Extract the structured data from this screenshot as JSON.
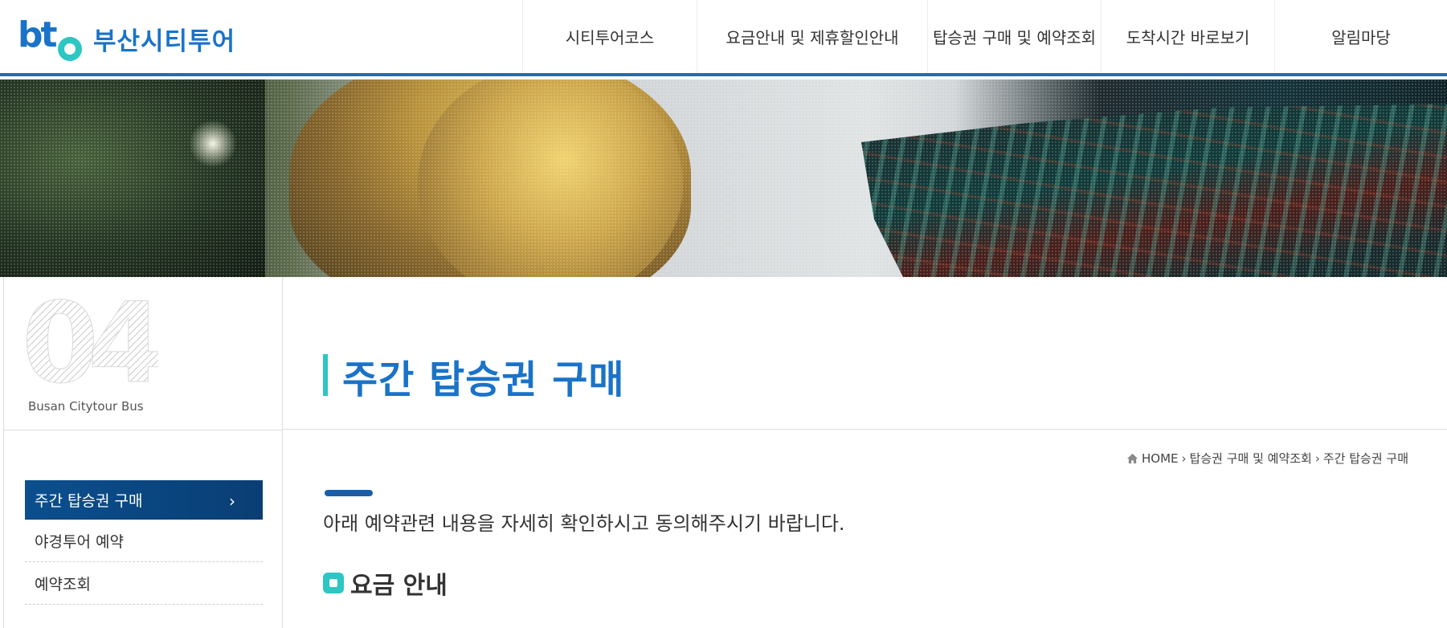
{
  "header": {
    "logo_mark": "bt",
    "logo_text": "부산시티투어",
    "nav": [
      {
        "label": "시티투어코스"
      },
      {
        "label": "요금안내 및 제휴할인안내"
      },
      {
        "label": "탑승권 구매 및 예약조회"
      },
      {
        "label": "도착시간 바로보기"
      },
      {
        "label": "알림마당"
      }
    ]
  },
  "sidebar": {
    "number": "04",
    "caption": "Busan Citytour Bus",
    "items": [
      {
        "label": "주간 탑승권 구매",
        "active": true
      },
      {
        "label": "야경투어 예약",
        "active": false
      },
      {
        "label": "예약조회",
        "active": false
      }
    ]
  },
  "main": {
    "title": "주간 탑승권 구매",
    "breadcrumb": {
      "home": "HOME",
      "level1": "탑승권 구매 및 예약조회",
      "level2": "주간 탑승권 구매"
    },
    "intro": "아래 예약관련 내용을 자세히 확인하시고 동의해주시기 바랍니다.",
    "section_title": "요금 안내"
  },
  "colors": {
    "brand_blue": "#1a73c8",
    "accent_teal": "#2cc6c3",
    "active_menu": "#0b4f8e"
  }
}
